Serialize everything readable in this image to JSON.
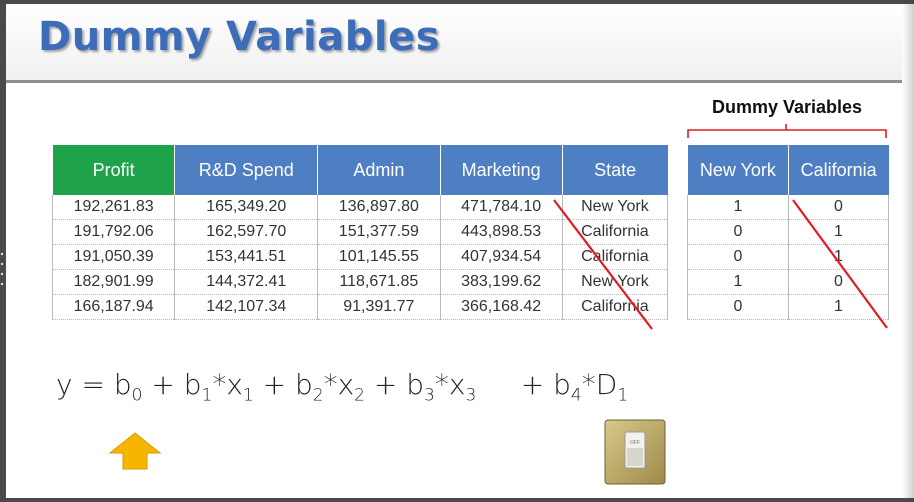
{
  "title": "Dummy Variables",
  "dummy_label": "Dummy Variables",
  "table": {
    "headers": [
      "Profit",
      "R&D Spend",
      "Admin",
      "Marketing",
      "State"
    ],
    "rows": [
      [
        "192,261.83",
        "165,349.20",
        "136,897.80",
        "471,784.10",
        "New York"
      ],
      [
        "191,792.06",
        "162,597.70",
        "151,377.59",
        "443,898.53",
        "California"
      ],
      [
        "191,050.39",
        "153,441.51",
        "101,145.55",
        "407,934.54",
        "California"
      ],
      [
        "182,901.99",
        "144,372.41",
        "118,671.85",
        "383,199.62",
        "New York"
      ],
      [
        "166,187.94",
        "142,107.34",
        "91,391.77",
        "366,168.42",
        "California"
      ]
    ]
  },
  "dummy_table": {
    "headers": [
      "New York",
      "California"
    ],
    "rows": [
      [
        "1",
        "0"
      ],
      [
        "0",
        "1"
      ],
      [
        "0",
        "1"
      ],
      [
        "1",
        "0"
      ],
      [
        "0",
        "1"
      ]
    ]
  },
  "equation": {
    "y": "y = b",
    "terms": [
      {
        "pre": "y = b",
        "sub": "0"
      },
      {
        "pre": " + b",
        "sub": "1"
      },
      {
        "pre": "*x",
        "sub": "1"
      },
      {
        "pre": " + b",
        "sub": "2"
      },
      {
        "pre": "*x",
        "sub": "2"
      },
      {
        "pre": " + b",
        "sub": "3"
      },
      {
        "pre": "*x",
        "sub": "3"
      },
      {
        "pre": "     + b",
        "sub": "4"
      },
      {
        "pre": "*D",
        "sub": "1"
      }
    ]
  },
  "switch_label": "OFF",
  "colors": {
    "title": "#3d6cb8",
    "header": "#4f7fc3",
    "profit_header": "#1fa34a",
    "strike": "#e01b24",
    "arrow": "#f7b500"
  },
  "icons": [
    "up-arrow-icon",
    "light-switch-icon"
  ]
}
